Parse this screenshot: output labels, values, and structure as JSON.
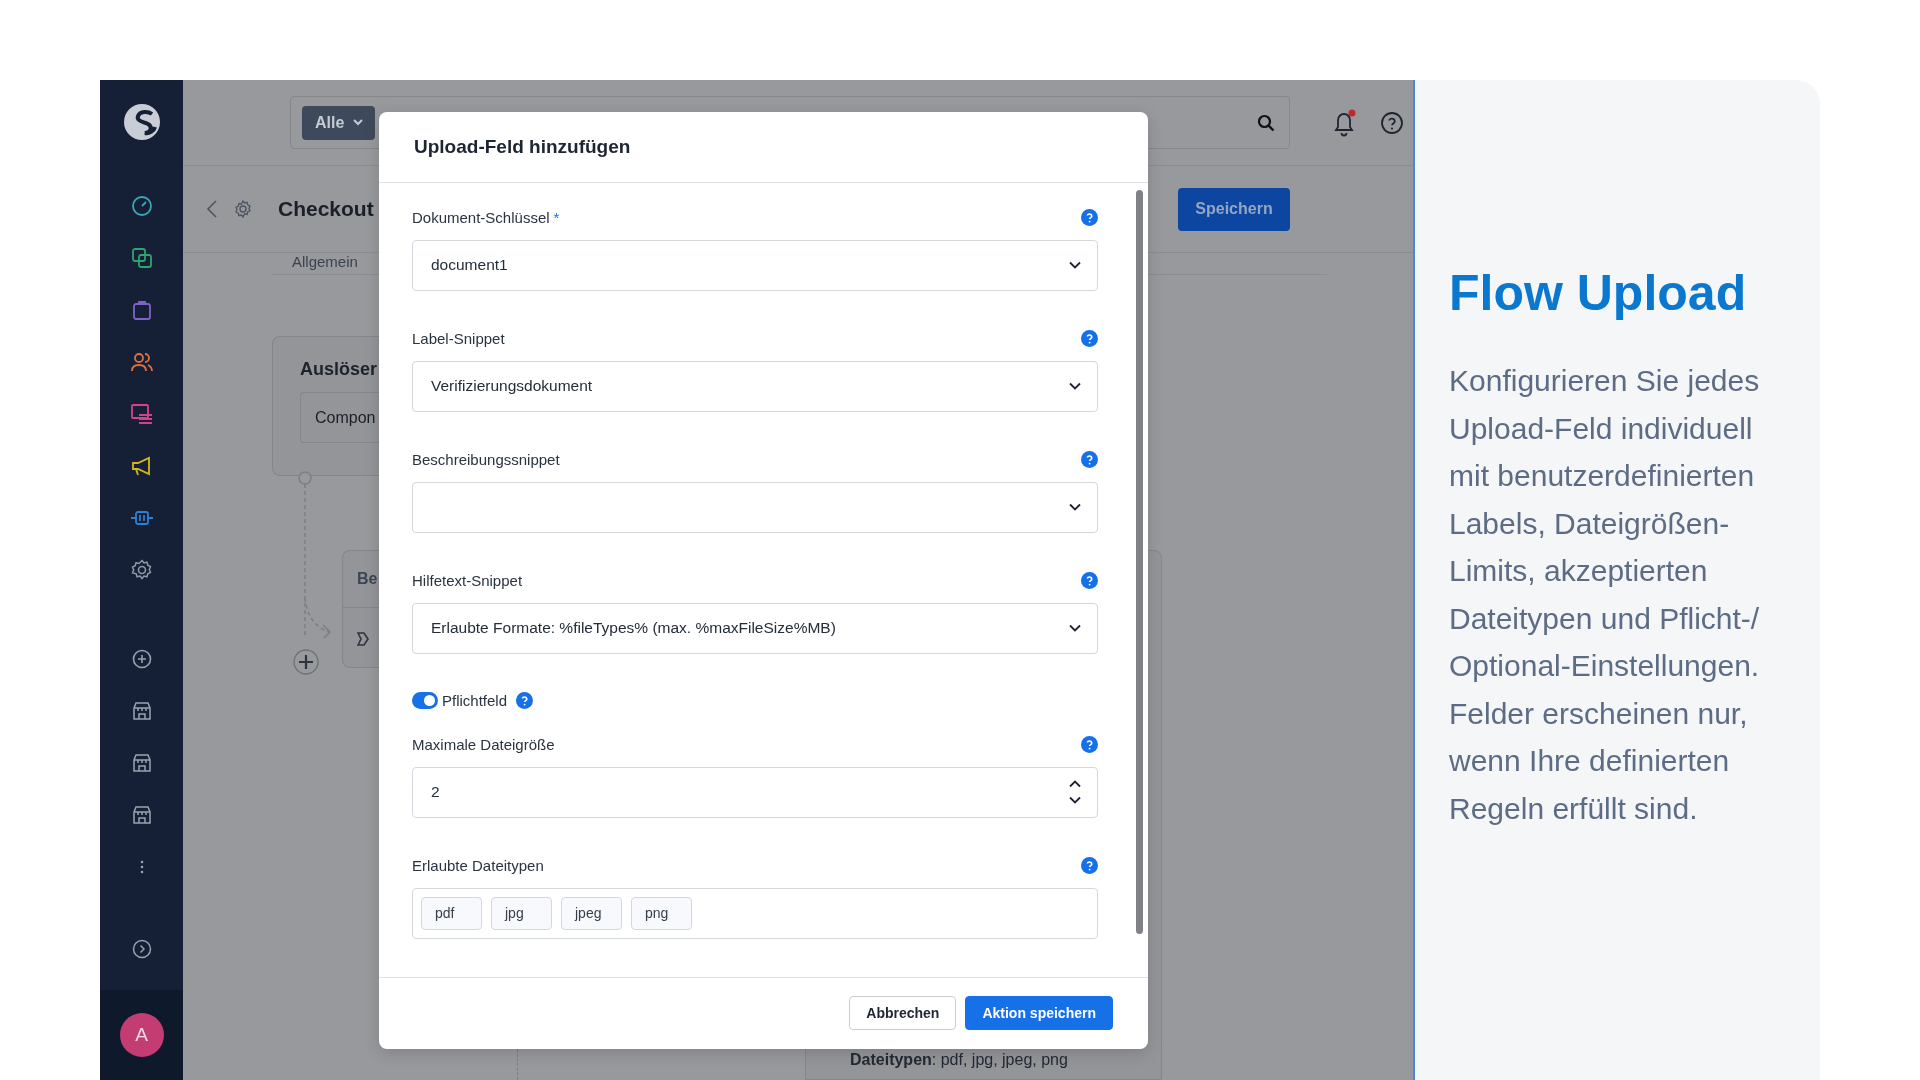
{
  "sidebar": {
    "avatar": "A"
  },
  "topbar": {
    "scope": "Alle"
  },
  "page": {
    "title": "Checkout",
    "save_button": "Speichern",
    "tab": "Allgemein"
  },
  "canvas": {
    "trigger": {
      "title": "Auslöser",
      "value": "Compon"
    },
    "step": {
      "title": "Be"
    },
    "summary": "**Dateitypen**: pdf, jpg, jpeg, png"
  },
  "modal": {
    "title": "Upload-Feld hinzufügen",
    "fields": [
      {
        "kind": "select",
        "label": "Dokument-Schlüssel",
        "required_mark": "*",
        "value": "document1"
      },
      {
        "kind": "select",
        "label": "Label-Snippet",
        "value": "Verifizierungsdokument"
      },
      {
        "kind": "select",
        "label": "Beschreibungssnippet"
      },
      {
        "kind": "select",
        "label": "Hilfetext-Snippet",
        "value": "Erlaubte Formate: %fileTypes% (max. %maxFileSize%MB)"
      },
      {
        "kind": "toggle",
        "label": "Pflichtfeld",
        "on": true
      },
      {
        "kind": "number",
        "label": "Maximale Dateigröße",
        "value": "2"
      },
      {
        "kind": "tags",
        "label": "Erlaubte Dateitypen",
        "tags": [
          "pdf",
          "jpg",
          "jpeg",
          "png"
        ]
      }
    ],
    "buttons": [
      {
        "kind": "secondary",
        "label": "Abbrechen"
      },
      {
        "kind": "primary",
        "label": "Aktion speichern"
      }
    ]
  },
  "info": {
    "title": "Flow Upload",
    "text": "Konfigurieren Sie jedes Upload-Feld individuell mit benutzerdefinierten Labels, Dateigrößen-Limits, akzeptierten Dateitypen und Pflicht-/ Optional-Einstellungen. Felder erscheinen nur, wenn Ihre definierten Regeln erfüllt sind."
  }
}
